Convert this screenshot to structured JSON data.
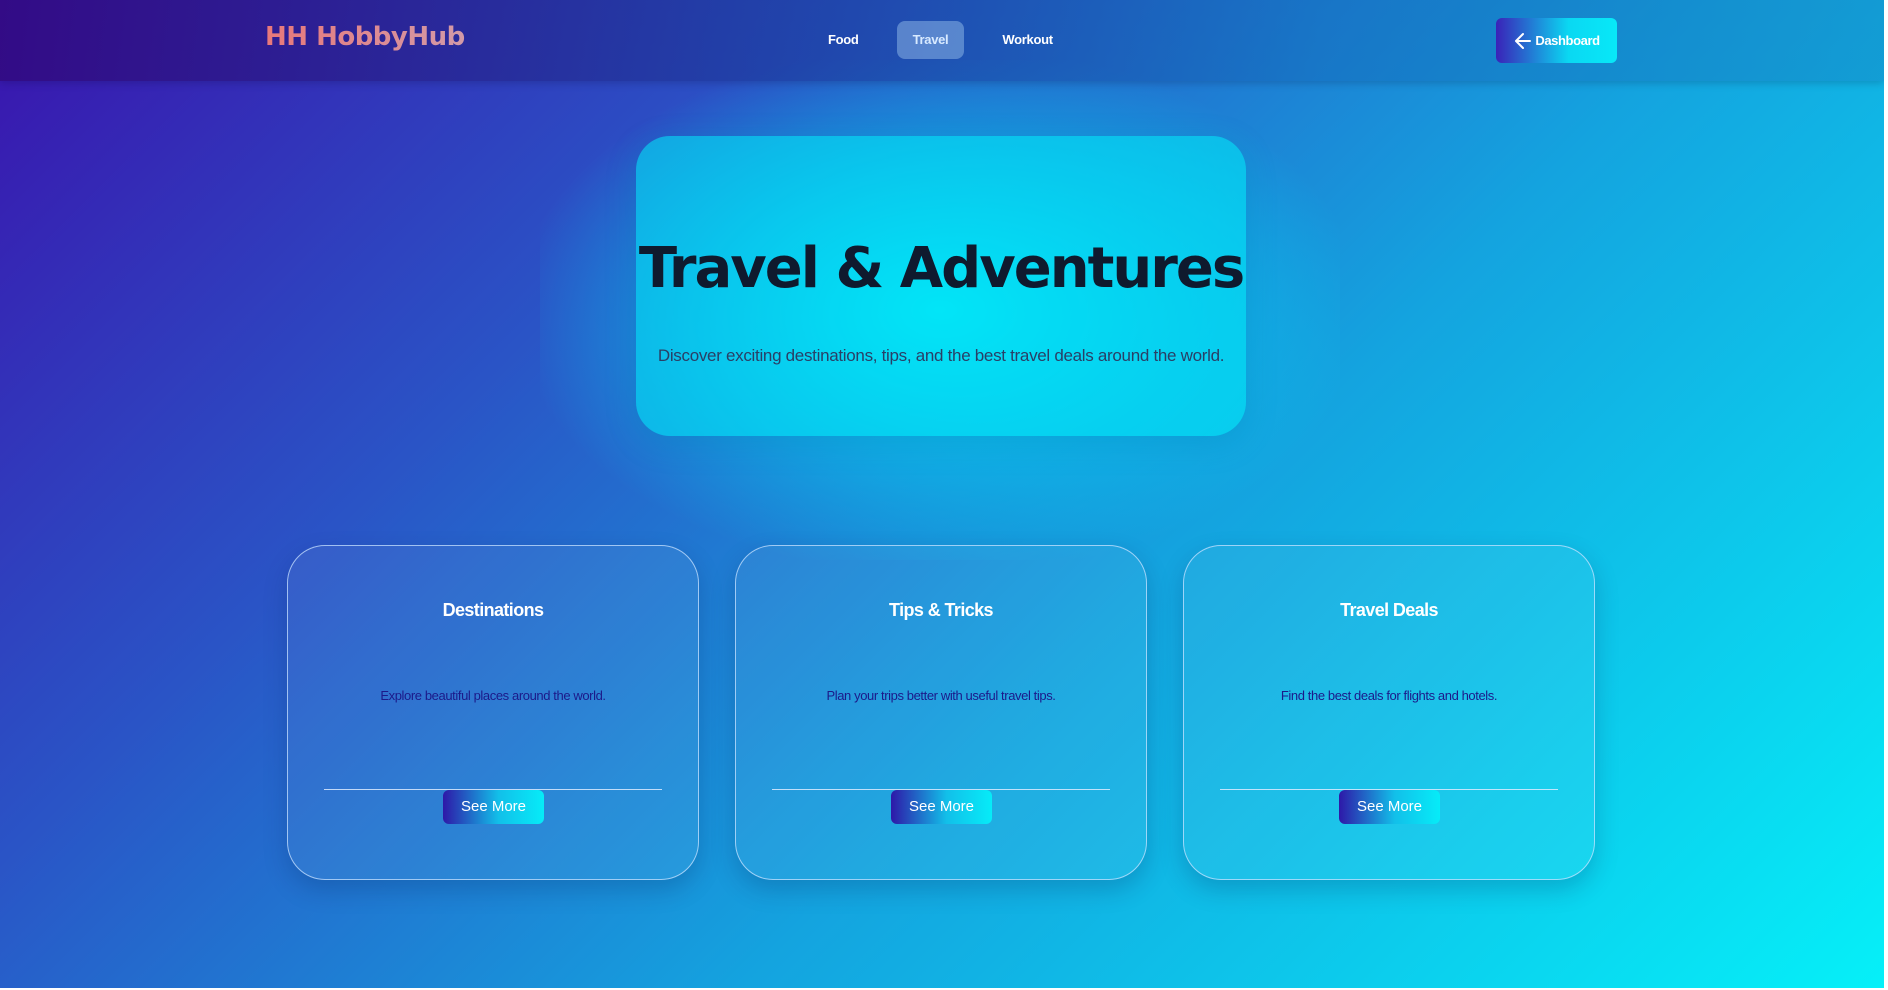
{
  "brand": {
    "logo_text": "HH HobbyHub"
  },
  "nav": {
    "links": [
      {
        "label": "Food",
        "active": false
      },
      {
        "label": "Travel",
        "active": true
      },
      {
        "label": "Workout",
        "active": false
      }
    ],
    "dashboard_label": "Dashboard"
  },
  "hero": {
    "title": "Travel & Adventures",
    "subtitle": "Discover exciting destinations, tips, and the best travel deals around the world."
  },
  "cards": [
    {
      "title": "Destinations",
      "description": "Explore beautiful places around the world.",
      "button_label": "See More"
    },
    {
      "title": "Tips & Tricks",
      "description": "Plan your trips better with useful travel tips.",
      "button_label": "See More"
    },
    {
      "title": "Travel Deals",
      "description": "Find the best deals for flights and hotels.",
      "button_label": "See More"
    }
  ],
  "colors": {
    "logo": "#e8787a",
    "title_text": "#0f1a2e",
    "card_desc": "#1c1a8a",
    "accent_start": "#2e18a8",
    "accent_end": "#06ecf8"
  },
  "icons": {
    "dashboard": "arrow-left-icon"
  }
}
